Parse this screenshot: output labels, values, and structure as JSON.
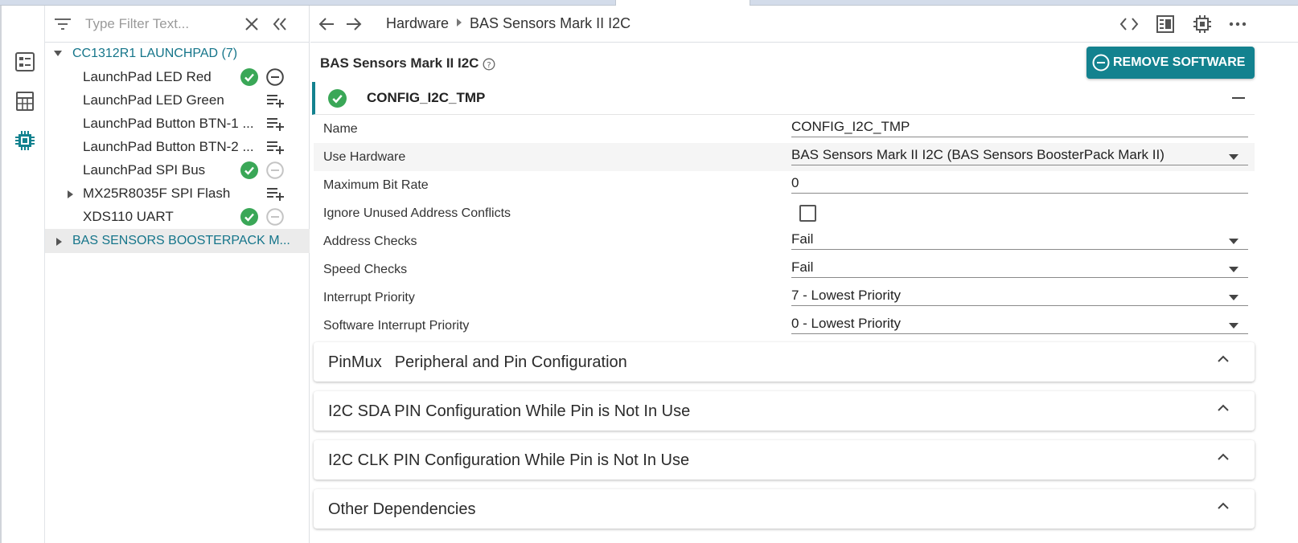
{
  "filter": {
    "placeholder": "Type Filter Text..."
  },
  "tree": {
    "groups": [
      {
        "label": "CC1312R1 LAUNCHPAD (7)"
      },
      {
        "label": "BAS SENSORS BOOSTERPACK M..."
      }
    ],
    "items": [
      {
        "label": "LaunchPad LED Red",
        "status": "check",
        "action": "remove"
      },
      {
        "label": "LaunchPad LED Green",
        "action": "add"
      },
      {
        "label": "LaunchPad Button BTN-1 ...",
        "action": "add"
      },
      {
        "label": "LaunchPad Button BTN-2 ...",
        "action": "add"
      },
      {
        "label": "LaunchPad SPI Bus",
        "status": "check",
        "action": "remove-disabled"
      },
      {
        "label": "MX25R8035F SPI Flash",
        "action": "add"
      },
      {
        "label": "XDS110 UART",
        "status": "check",
        "action": "remove-disabled"
      }
    ]
  },
  "breadcrumb": {
    "root": "Hardware",
    "current": "BAS Sensors Mark II I2C"
  },
  "page": {
    "title": "BAS Sensors Mark II I2C",
    "remove_button": "REMOVE SOFTWARE"
  },
  "config": {
    "name": "CONFIG_I2C_TMP",
    "properties": [
      {
        "label": "Name",
        "value": "CONFIG_I2C_TMP",
        "type": "text"
      },
      {
        "label": "Use Hardware",
        "value": "BAS Sensors Mark II I2C (BAS Sensors BoosterPack Mark II)",
        "type": "select"
      },
      {
        "label": "Maximum Bit Rate",
        "value": "0",
        "type": "text"
      },
      {
        "label": "Ignore Unused Address Conflicts",
        "value": "",
        "type": "checkbox",
        "checked": false
      },
      {
        "label": "Address Checks",
        "value": "Fail",
        "type": "select"
      },
      {
        "label": "Speed Checks",
        "value": "Fail",
        "type": "select"
      },
      {
        "label": "Interrupt Priority",
        "value": "7 - Lowest Priority",
        "type": "select"
      },
      {
        "label": "Software Interrupt Priority",
        "value": "0 - Lowest Priority",
        "type": "select"
      }
    ]
  },
  "sections": [
    {
      "title": "PinMux",
      "subtitle": "Peripheral and Pin Configuration"
    },
    {
      "title": "I2C SDA PIN Configuration While Pin is Not In Use"
    },
    {
      "title": "I2C CLK PIN Configuration While Pin is Not In Use"
    },
    {
      "title": "Other Dependencies"
    }
  ],
  "colors": {
    "accent": "#13828f",
    "check": "#3aa757",
    "group_text": "#15758a"
  }
}
